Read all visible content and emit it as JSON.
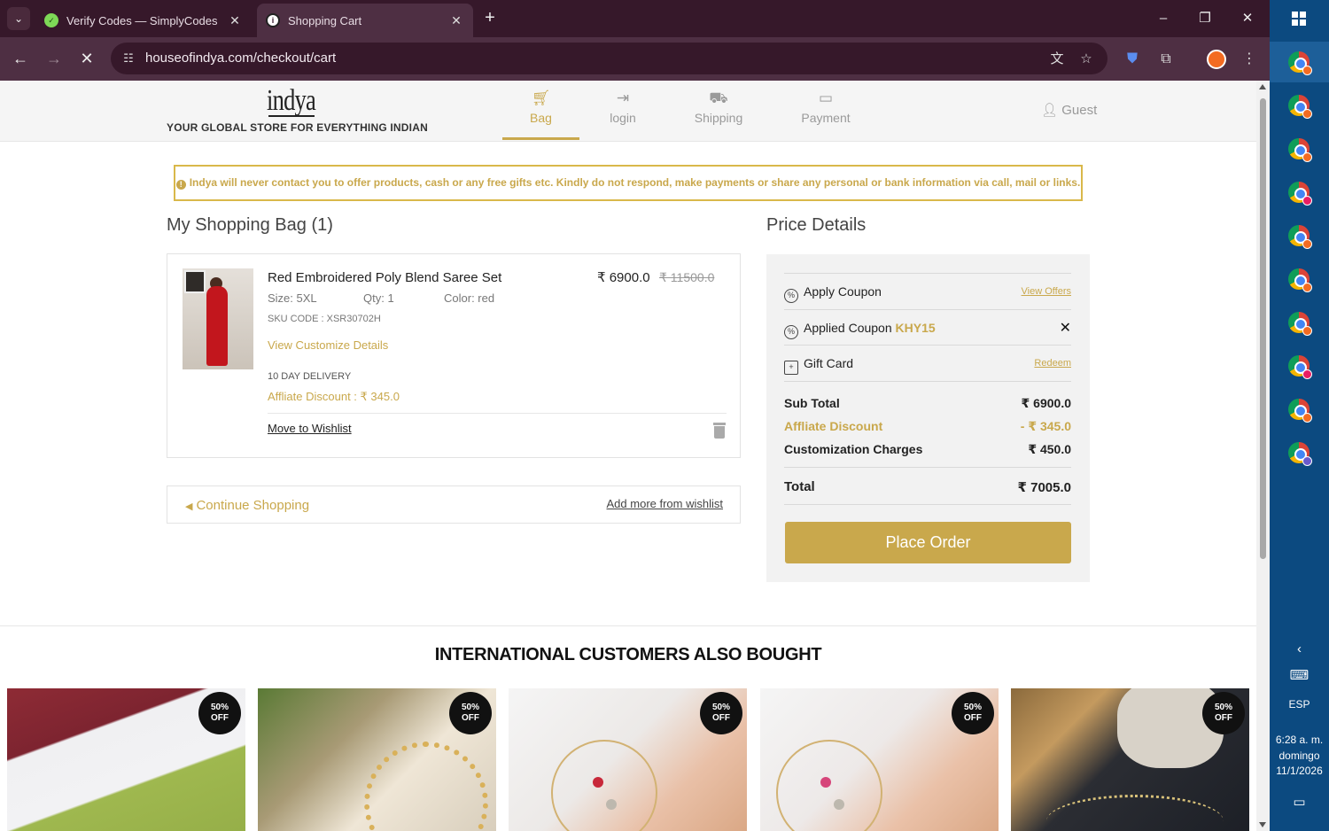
{
  "browser": {
    "tabs": [
      {
        "title": "Verify Codes — SimplyCodes",
        "active": false
      },
      {
        "title": "Shopping Cart",
        "active": true
      }
    ],
    "url": "houseofindya.com/checkout/cart"
  },
  "header": {
    "logo": "indya",
    "tagline": "YOUR GLOBAL STORE FOR EVERYTHING INDIAN",
    "steps": [
      {
        "label": "Bag",
        "icon": "cart-icon",
        "active": true
      },
      {
        "label": "login",
        "icon": "sign-in-icon",
        "active": false
      },
      {
        "label": "Shipping",
        "icon": "truck-icon",
        "active": false
      },
      {
        "label": "Payment",
        "icon": "credit-card-icon",
        "active": false
      }
    ],
    "user": "Guest"
  },
  "notice": "Indya will never contact you to offer products, cash or any free gifts etc. Kindly do not respond, make payments or share any personal or bank information via call, mail or links.",
  "bag": {
    "title": "My Shopping Bag (1)",
    "item": {
      "name": "Red Embroidered Poly Blend Saree Set",
      "size": "Size: 5XL",
      "qty": "Qty: 1",
      "color": "Color: red",
      "sku": "SKU CODE : XSR30702H",
      "customize_link": "View Customize Details",
      "delivery": "10 DAY DELIVERY",
      "affiliate_discount": "Affliate Discount : ₹ 345.0",
      "price": "₹ 6900.0",
      "original_price": "₹ 11500.0",
      "move_to_wishlist": "Move to Wishlist"
    },
    "continue_shopping": "Continue Shopping",
    "add_from_wishlist": "Add more from wishlist"
  },
  "price_details": {
    "title": "Price Details",
    "apply_coupon": "Apply Coupon",
    "view_offers": "View Offers",
    "applied_coupon_label": "Applied Coupon",
    "applied_coupon_code": "KHY15",
    "gift_card": "Gift Card",
    "redeem": "Redeem",
    "sub_total_label": "Sub Total",
    "sub_total": "₹ 6900.0",
    "affiliate_label": "Affliate Discount",
    "affiliate_value": "- ₹ 345.0",
    "customization_label": "Customization Charges",
    "customization_value": "₹ 450.0",
    "total_label": "Total",
    "total": "₹ 7005.0",
    "place_order": "Place Order"
  },
  "recommendations": {
    "title": "INTERNATIONAL CUSTOMERS ALSO BOUGHT",
    "badge_line1": "50%",
    "badge_line2": "OFF"
  },
  "taskbar": {
    "language": "ESP",
    "time": "6:28 a. m.",
    "day": "domingo",
    "date": "11/1/2026"
  },
  "colors": {
    "accent_gold": "#c9a84c",
    "browser_frame": "#36182a",
    "taskbar": "#0c4a80"
  }
}
